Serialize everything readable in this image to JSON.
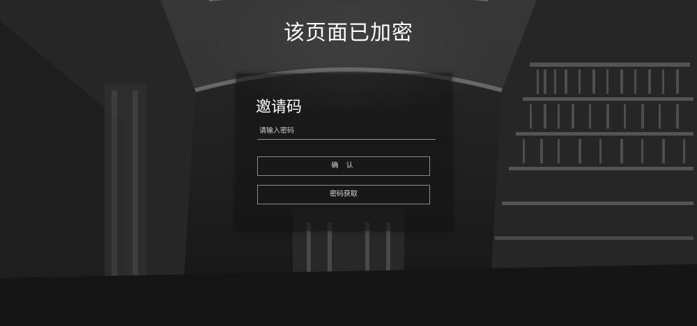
{
  "page": {
    "title": "该页面已加密"
  },
  "form": {
    "heading": "邀请码",
    "password_placeholder": "请输入密码",
    "password_value": "",
    "confirm_label": "确 认",
    "get_password_label": "密码获取"
  }
}
